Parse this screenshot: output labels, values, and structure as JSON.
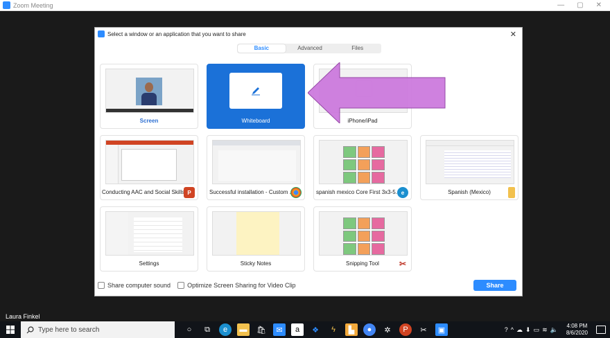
{
  "zoom_window": {
    "title": "Zoom Meeting"
  },
  "participant": {
    "name": "Laura Finkel"
  },
  "dialog": {
    "title": "Select a window or an application that you want to share",
    "tabs": [
      {
        "label": "Basic",
        "active": true
      },
      {
        "label": "Advanced",
        "active": false
      },
      {
        "label": "Files",
        "active": false
      }
    ],
    "items": [
      {
        "label": "Screen"
      },
      {
        "label": "Whiteboard"
      },
      {
        "label": "iPhone/iPad"
      },
      {
        "label": "Conducting AAC and Social Skills..."
      },
      {
        "label": "Successful installation - Custom ..."
      },
      {
        "label": "spanish mexico Core First 3x3-5..."
      },
      {
        "label": "Spanish (Mexico)"
      },
      {
        "label": "Settings"
      },
      {
        "label": "Sticky Notes"
      },
      {
        "label": "Snipping Tool"
      }
    ],
    "share_sound_label": "Share computer sound",
    "optimize_label": "Optimize Screen Sharing for Video Clip",
    "share_button": "Share"
  },
  "taskbar": {
    "search_placeholder": "Type here to search",
    "time": "4:08 PM",
    "date": "8/6/2020"
  },
  "colors": {
    "accent": "#2d8cff",
    "selected_card": "#1b71d8",
    "arrow": "#cc77dd"
  }
}
